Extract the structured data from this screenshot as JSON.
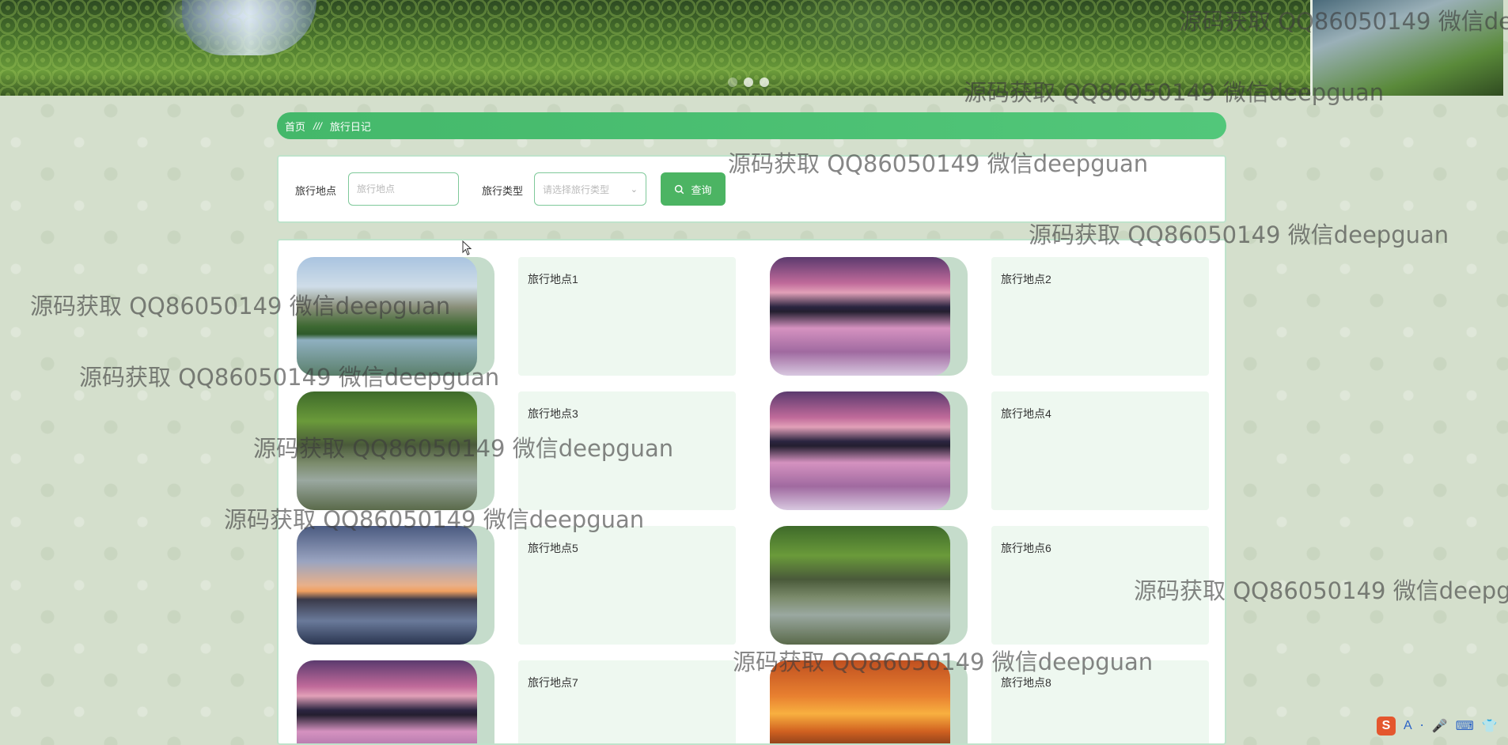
{
  "banner": {
    "slides": 3,
    "active_slide": 1
  },
  "breadcrumb": {
    "home": "首页",
    "separator": "///",
    "current": "旅行日记"
  },
  "search": {
    "location_label": "旅行地点",
    "location_placeholder": "旅行地点",
    "type_label": "旅行类型",
    "type_placeholder": "请选择旅行类型",
    "button_label": "查询"
  },
  "items": [
    {
      "title": "旅行地点1",
      "image": "mountain-lake"
    },
    {
      "title": "旅行地点2",
      "image": "sunset-lake"
    },
    {
      "title": "旅行地点3",
      "image": "river-rocks"
    },
    {
      "title": "旅行地点4",
      "image": "sunset-lake"
    },
    {
      "title": "旅行地点5",
      "image": "pier-sunset"
    },
    {
      "title": "旅行地点6",
      "image": "river-rocks"
    },
    {
      "title": "旅行地点7",
      "image": "sunset-lake"
    },
    {
      "title": "旅行地点8",
      "image": "lighthouse-sunset"
    }
  ],
  "watermark_text": "源码获取 QQ86050149 微信deepguan",
  "colors": {
    "accent": "#4cb463",
    "panel_border": "#bfe3cb",
    "info_bg": "#eef8f0"
  },
  "ime_tray": {
    "logo": "S",
    "letter": "A"
  }
}
